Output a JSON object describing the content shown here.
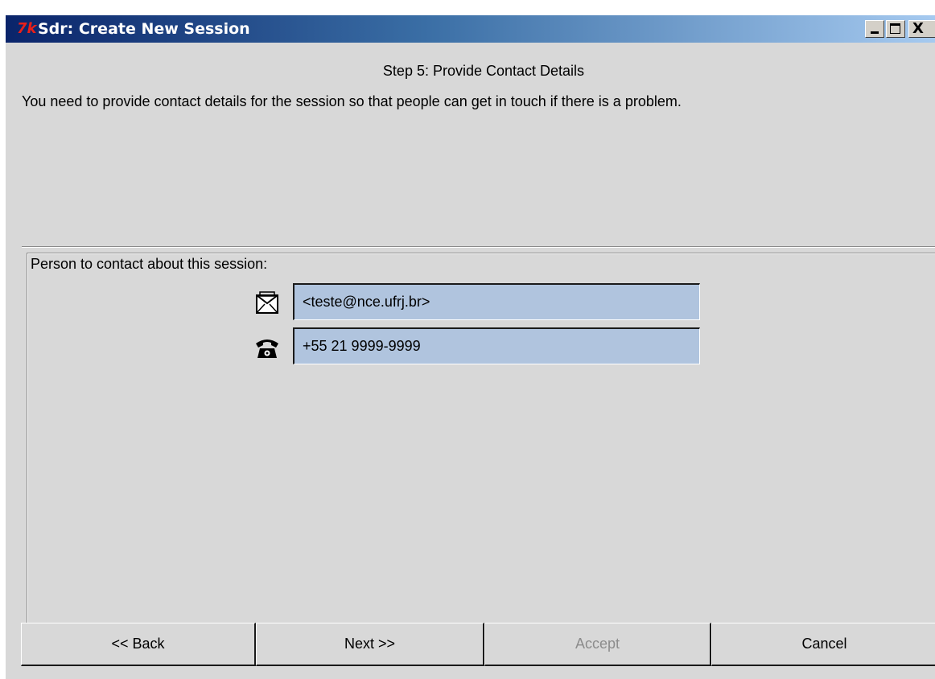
{
  "window": {
    "title": "Sdr: Create New Session",
    "icon_text": "7k"
  },
  "window_controls": {
    "minimize_label": "_",
    "maximize_label": "□",
    "close_label": "X"
  },
  "step": {
    "title": "Step 5: Provide Contact Details",
    "description": "You need to provide contact details for the session so that people can get in touch if there is a problem."
  },
  "contact": {
    "label": "Person to contact about this session:",
    "email_icon": "envelope-icon",
    "email_value": "<teste@nce.ufrj.br>",
    "phone_icon": "telephone-icon",
    "phone_value": "+55 21 9999-9999"
  },
  "buttons": {
    "back": "<< Back",
    "next": "Next >>",
    "accept": "Accept",
    "cancel": "Cancel"
  },
  "colors": {
    "field_background": "#b0c4de",
    "window_background": "#d8d8d8",
    "titlebar_start": "#0a246a",
    "titlebar_end": "#a6caf0",
    "disabled_text": "#8c8c8c"
  }
}
